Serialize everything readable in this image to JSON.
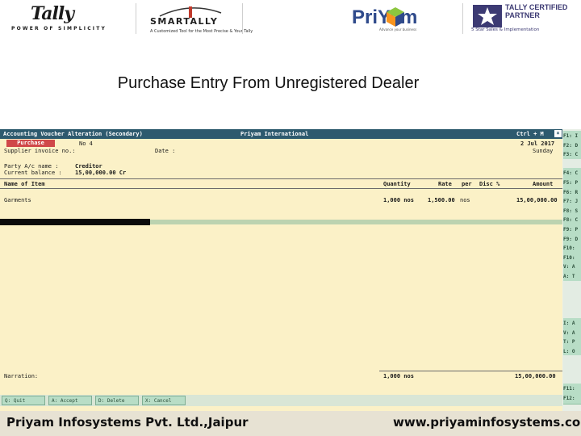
{
  "logos": {
    "tally_word": "Tally",
    "tally_tagline": "POWER OF SIMPLICITY",
    "smartally_word": "SMARTALLY",
    "smartally_tagline": "A Customized Tool for the Most Precise & Your Tally",
    "priyam_word": "PriYam",
    "priyam_tagline": "Advance your business",
    "certified_word": "TALLY CERTIFIED PARTNER",
    "certified_tagline": "5 Star Sales & Implementation"
  },
  "slide_title": "Purchase Entry From Unregistered Dealer",
  "tally": {
    "title_left": "Accounting Voucher Alteration (Secondary)",
    "title_center": "Priyam International",
    "title_right": "Ctrl + M",
    "close_glyph": "×",
    "voucher_type": "Purchase",
    "voucher_no": "No 4",
    "date": "2 Jul 2017",
    "day": "Sunday",
    "supplier_invoice_label": "Supplier invoice no.:",
    "date_label": "Date :",
    "party_label": "Party A/c name  :",
    "party_value": "Creditor",
    "current_balance_label": "Current balance  :",
    "current_balance_value": "15,00,000.00 Cr",
    "columns": {
      "name": "Name of Item",
      "quantity": "Quantity",
      "rate": "Rate",
      "per": "per",
      "disc": "Disc %",
      "amount": "Amount"
    },
    "items": [
      {
        "name": "Garments",
        "quantity": "1,000 nos",
        "rate": "1,500.00",
        "per": "nos",
        "amount": "15,00,000.00"
      }
    ],
    "narration_label": "Narration:",
    "total_quantity": "1,000 nos",
    "total_amount": "15,00,000.00",
    "buttons": [
      "Q: Quit",
      "A: Accept",
      "D: Delete",
      "X: Cancel"
    ],
    "fkeys": [
      "F1: I",
      "F2: D",
      "F3: C",
      "",
      "F4: C",
      "F5: P",
      "F6: R",
      "F7: J",
      "F8: S",
      "F8: C",
      "F9: P",
      "F9: D",
      "F10:",
      "F10:",
      "V: A",
      "A: T",
      "",
      "",
      "",
      "",
      "I: A",
      "V: A",
      "T: P",
      "L: O",
      "",
      "",
      "",
      "F11:",
      "F12:"
    ]
  },
  "footer": {
    "left": "Priyam Infosystems Pvt. Ltd.,Jaipur",
    "right": "www.priyaminfosystems.com"
  }
}
